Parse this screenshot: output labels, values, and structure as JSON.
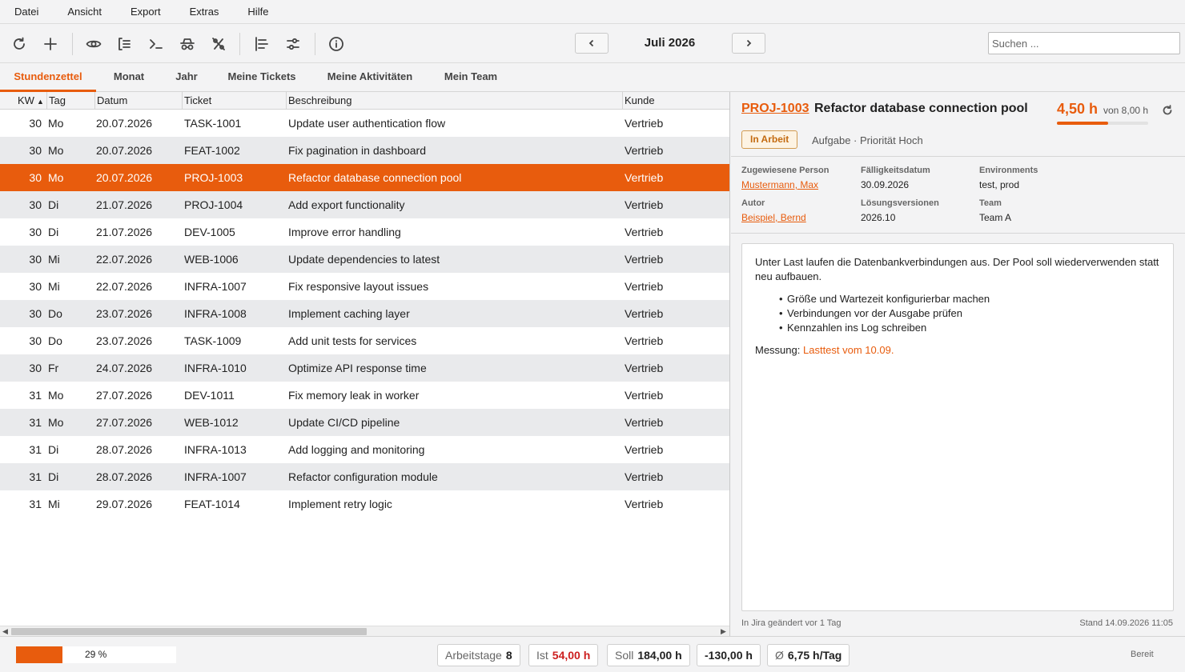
{
  "menu": [
    "Datei",
    "Ansicht",
    "Export",
    "Extras",
    "Hilfe"
  ],
  "toolbar": {
    "month": "Juli 2026",
    "search_placeholder": "Suchen ..."
  },
  "tabs": [
    "Stundenzettel",
    "Monat",
    "Jahr",
    "Meine Tickets",
    "Meine Aktivitäten",
    "Mein Team"
  ],
  "active_tab": "Stundenzettel",
  "table": {
    "columns": [
      "KW",
      "Tag",
      "Datum",
      "Ticket",
      "Beschreibung",
      "Kunde"
    ],
    "sort_column": "KW",
    "selected_index": 2,
    "rows": [
      {
        "kw": "30",
        "tag": "Mo",
        "datum": "20.07.2026",
        "ticket": "TASK-1001",
        "beschreibung": "Update user authentication flow",
        "kunde": "Vertrieb"
      },
      {
        "kw": "30",
        "tag": "Mo",
        "datum": "20.07.2026",
        "ticket": "FEAT-1002",
        "beschreibung": "Fix pagination in dashboard",
        "kunde": "Vertrieb"
      },
      {
        "kw": "30",
        "tag": "Mo",
        "datum": "20.07.2026",
        "ticket": "PROJ-1003",
        "beschreibung": "Refactor database connection pool",
        "kunde": "Vertrieb"
      },
      {
        "kw": "30",
        "tag": "Di",
        "datum": "21.07.2026",
        "ticket": "PROJ-1004",
        "beschreibung": "Add export functionality",
        "kunde": "Vertrieb"
      },
      {
        "kw": "30",
        "tag": "Di",
        "datum": "21.07.2026",
        "ticket": "DEV-1005",
        "beschreibung": "Improve error handling",
        "kunde": "Vertrieb"
      },
      {
        "kw": "30",
        "tag": "Mi",
        "datum": "22.07.2026",
        "ticket": "WEB-1006",
        "beschreibung": "Update dependencies to latest",
        "kunde": "Vertrieb"
      },
      {
        "kw": "30",
        "tag": "Mi",
        "datum": "22.07.2026",
        "ticket": "INFRA-1007",
        "beschreibung": "Fix responsive layout issues",
        "kunde": "Vertrieb"
      },
      {
        "kw": "30",
        "tag": "Do",
        "datum": "23.07.2026",
        "ticket": "INFRA-1008",
        "beschreibung": "Implement caching layer",
        "kunde": "Vertrieb"
      },
      {
        "kw": "30",
        "tag": "Do",
        "datum": "23.07.2026",
        "ticket": "TASK-1009",
        "beschreibung": "Add unit tests for services",
        "kunde": "Vertrieb"
      },
      {
        "kw": "30",
        "tag": "Fr",
        "datum": "24.07.2026",
        "ticket": "INFRA-1010",
        "beschreibung": "Optimize API response time",
        "kunde": "Vertrieb"
      },
      {
        "kw": "31",
        "tag": "Mo",
        "datum": "27.07.2026",
        "ticket": "DEV-1011",
        "beschreibung": "Fix memory leak in worker",
        "kunde": "Vertrieb"
      },
      {
        "kw": "31",
        "tag": "Mo",
        "datum": "27.07.2026",
        "ticket": "WEB-1012",
        "beschreibung": "Update CI/CD pipeline",
        "kunde": "Vertrieb"
      },
      {
        "kw": "31",
        "tag": "Di",
        "datum": "28.07.2026",
        "ticket": "INFRA-1013",
        "beschreibung": "Add logging and monitoring",
        "kunde": "Vertrieb"
      },
      {
        "kw": "31",
        "tag": "Di",
        "datum": "28.07.2026",
        "ticket": "INFRA-1007",
        "beschreibung": "Refactor configuration module",
        "kunde": "Vertrieb"
      },
      {
        "kw": "31",
        "tag": "Mi",
        "datum": "29.07.2026",
        "ticket": "FEAT-1014",
        "beschreibung": "Implement retry logic",
        "kunde": "Vertrieb"
      }
    ]
  },
  "detail": {
    "key": "PROJ-1003",
    "title": "Refactor database connection pool",
    "hours": "4,50 h",
    "of_hours": "von 8,00 h",
    "progress_fraction": 0.5625,
    "status": "In Arbeit",
    "type_priority": "Aufgabe · Priorität Hoch",
    "fields": {
      "assignee_label": "Zugewiesene Person",
      "assignee": "Mustermann, Max",
      "due_label": "Fälligkeitsdatum",
      "due": "30.09.2026",
      "env_label": "Environments",
      "env": "test, prod",
      "author_label": "Autor",
      "author": "Beispiel, Bernd",
      "versions_label": "Lösungsversionen",
      "versions": "2026.10",
      "team_label": "Team",
      "team": "Team A"
    },
    "description": {
      "intro": "Unter Last laufen die Datenbankverbindungen aus. Der Pool soll wiederverwenden statt neu aufbauen.",
      "bullets": [
        "Größe und Wartezeit konfigurierbar machen",
        "Verbindungen vor der Ausgabe prüfen",
        "Kennzahlen ins Log schreiben"
      ],
      "measure_label": "Messung:",
      "measure_link": "Lasttest vom 10.09."
    },
    "footer_left": "In Jira geändert vor 1 Tag",
    "footer_right": "Stand 14.09.2026 11:05"
  },
  "statusbar": {
    "progress_text": "29 %",
    "progress_fraction": 0.29,
    "workdays_label": "Arbeitstage",
    "workdays": "8",
    "ist_label": "Ist",
    "ist": "54,00 h",
    "soll_label": "Soll",
    "soll": "184,00 h",
    "diff": "-130,00 h",
    "avg_label": "Ø",
    "avg": "6,75 h/Tag",
    "state": "Bereit"
  },
  "colors": {
    "accent": "#e85c0d",
    "row_alt": "#e9eaec",
    "negative": "#cc1f1f"
  }
}
